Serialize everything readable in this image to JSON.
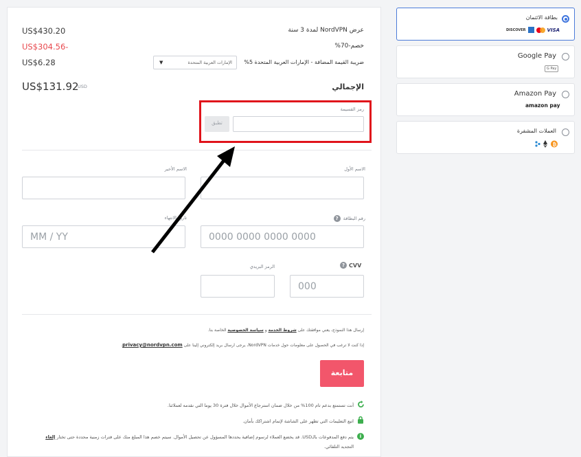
{
  "summary": {
    "offer_label": "عرض NordVPN لمدة 3 سنة",
    "offer_price": "US$430.20",
    "discount_label": "خصم-70%",
    "discount_price": "US$304.56-",
    "vat_label": "ضريبة القيمة المضافة - الإمارات العربية المتحدة 5%",
    "vat_price": "US$6.28",
    "country_select": "الإمارات العربية المتحدة",
    "total_label": "الإجمالي",
    "total_price": "US$131.92",
    "total_currency": "USD"
  },
  "coupon": {
    "label": "رمز القسيمة",
    "apply_label": "تطبق",
    "value": ""
  },
  "form": {
    "first_name_label": "الاسم الأول",
    "last_name_label": "الاسم الأخير",
    "card_number_label": "رقم البطاقة",
    "card_number_placeholder": "0000 0000 0000 0000",
    "expiry_label": "تاريخ الانتهاء",
    "expiry_placeholder": "MM / YY",
    "cvv_label": "CVV",
    "cvv_placeholder": "000",
    "zip_label": "الرمز البريدي"
  },
  "legal": {
    "terms_prefix": "إرسال هذا النموذج، يعني موافقتك على",
    "terms_link": "شروط الخدمة",
    "terms_and": "و",
    "privacy_link": "سياسة الخصوصية",
    "terms_suffix": "الخاصة بنا.",
    "optout_text": "إذا كنت لا ترغب في الحصول على معلومات حول خدمات NordVPN، يرجى ارسال بريد إلكتروني إلينا على",
    "optout_email": "privacy@nordvpn.com",
    "optout_end": "."
  },
  "submit_label": "متابعة",
  "notes": {
    "refund": "أنت تستمتع بدعم تام 100% من خلال ضمان استرجاع الأموال خلال فترة 30 يوما التي نقدمه لعملائنا.",
    "secure": "اتبع التعليمات التي تظهر على الشاشة لإتمام اشتراكك بأمان.",
    "billing_1": "يتم دفع المدفوعات بالـUSD. قد يخضع العملاء لرسوم إضافية يحددها المسؤول عن تحصيل الأموال. سيتم خصم هذا المبلغ منك على فترات زمنية محددة حتى تختار",
    "billing_link": "إلغاء",
    "billing_2": "التجديد التلقائي."
  },
  "payment_methods": {
    "card_label": "بطاقة الائتمان",
    "card_logos": [
      "DISCOVER",
      "VISA"
    ],
    "google_pay_label": "Google Pay",
    "google_pay_logo": "G Pay",
    "amazon_pay_label": "Amazon Pay",
    "amazon_pay_logo": "amazon pay",
    "crypto_label": "العملات المشفرة"
  },
  "colors": {
    "discount_red": "#e8484d",
    "submit_button": "#f2566b",
    "highlight_box": "#e0131b",
    "selected_radio": "#3e74dd"
  },
  "icons": [
    "arrow-icon",
    "help-icon",
    "refresh-icon",
    "lock-icon",
    "info-icon",
    "bitcoin-icon",
    "ethereum-icon",
    "ripple-icon",
    "mastercard-icon",
    "amex-icon"
  ]
}
